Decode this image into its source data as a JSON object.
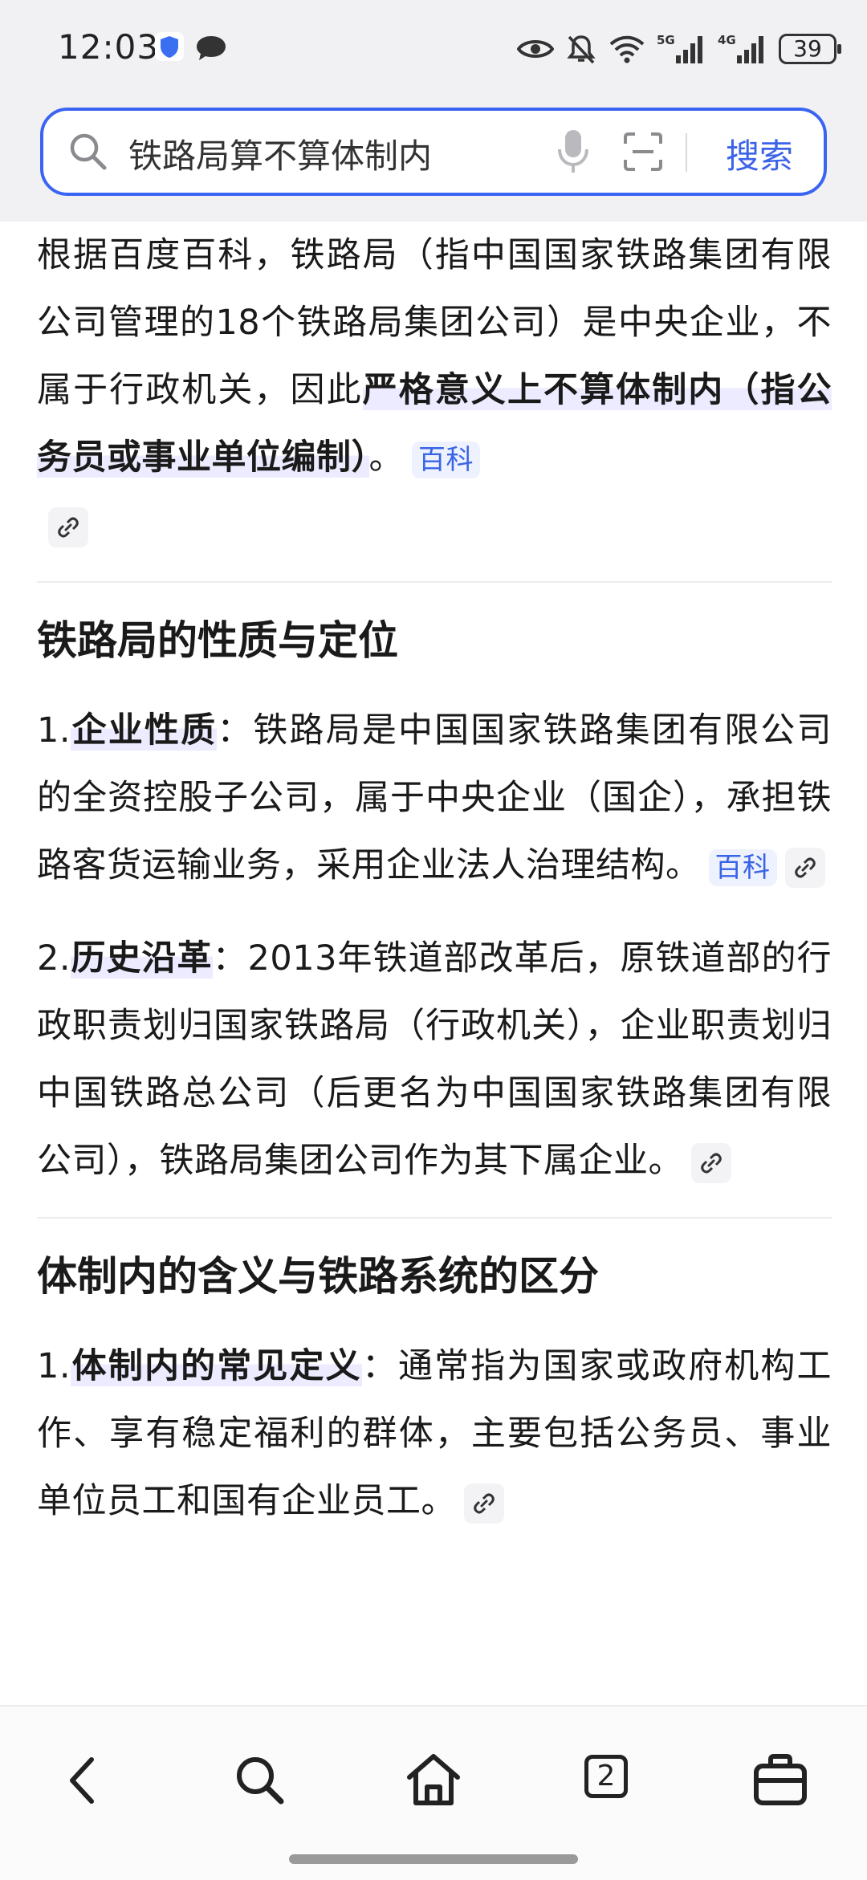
{
  "status_bar": {
    "time": "12:03",
    "battery": "39",
    "network_1": "5G",
    "network_2": "4G"
  },
  "search": {
    "query": "铁路局算不算体制内",
    "button_label": "搜索"
  },
  "answer": {
    "intro_part1": "根据百度百科，铁路局（指中国国家铁路集团有限公司管理的18个铁路局集团公司）是中央企业，不属于行政机关，因此",
    "intro_highlight": "严格意义上不算体制内（指公务员或事业单位编制）",
    "intro_end": "。",
    "intro_tag": "百科",
    "section1_title": "铁路局的性质与定位",
    "s1_item1_num": "1.",
    "s1_item1_term": "企业性质",
    "s1_item1_text": "：铁路局是中国国家铁路集团有限公司的全资控股子公司，属于中央企业（国企），承担铁路客货运输业务，采用企业法人治理结构。",
    "s1_item1_tag": "百科",
    "s1_item2_num": "2.",
    "s1_item2_term": "历史沿革",
    "s1_item2_text": "：2013年铁道部改革后，原铁道部的行政职责划归国家铁路局（行政机关），企业职责划归中国铁路总公司（后更名为中国国家铁路集团有限公司），铁路局集团公司作为其下属企业。",
    "section2_title": "体制内的含义与铁路系统的区分",
    "s2_item1_num": "1.",
    "s2_item1_term": "体制内的常见定义",
    "s2_item1_text": "：通常指为国家或政府机构工作、享有稳定福利的群体，主要包括公务员、事业单位员工和国有企业员工。"
  },
  "bottom_nav": {
    "tab_count": "2",
    "icons": [
      "back-icon",
      "search-icon",
      "home-icon",
      "tabs-icon",
      "toolbox-icon"
    ]
  },
  "colors": {
    "accent": "#3a64f2",
    "tag_bg": "#eef2fe",
    "highlight": "#ecebff"
  }
}
